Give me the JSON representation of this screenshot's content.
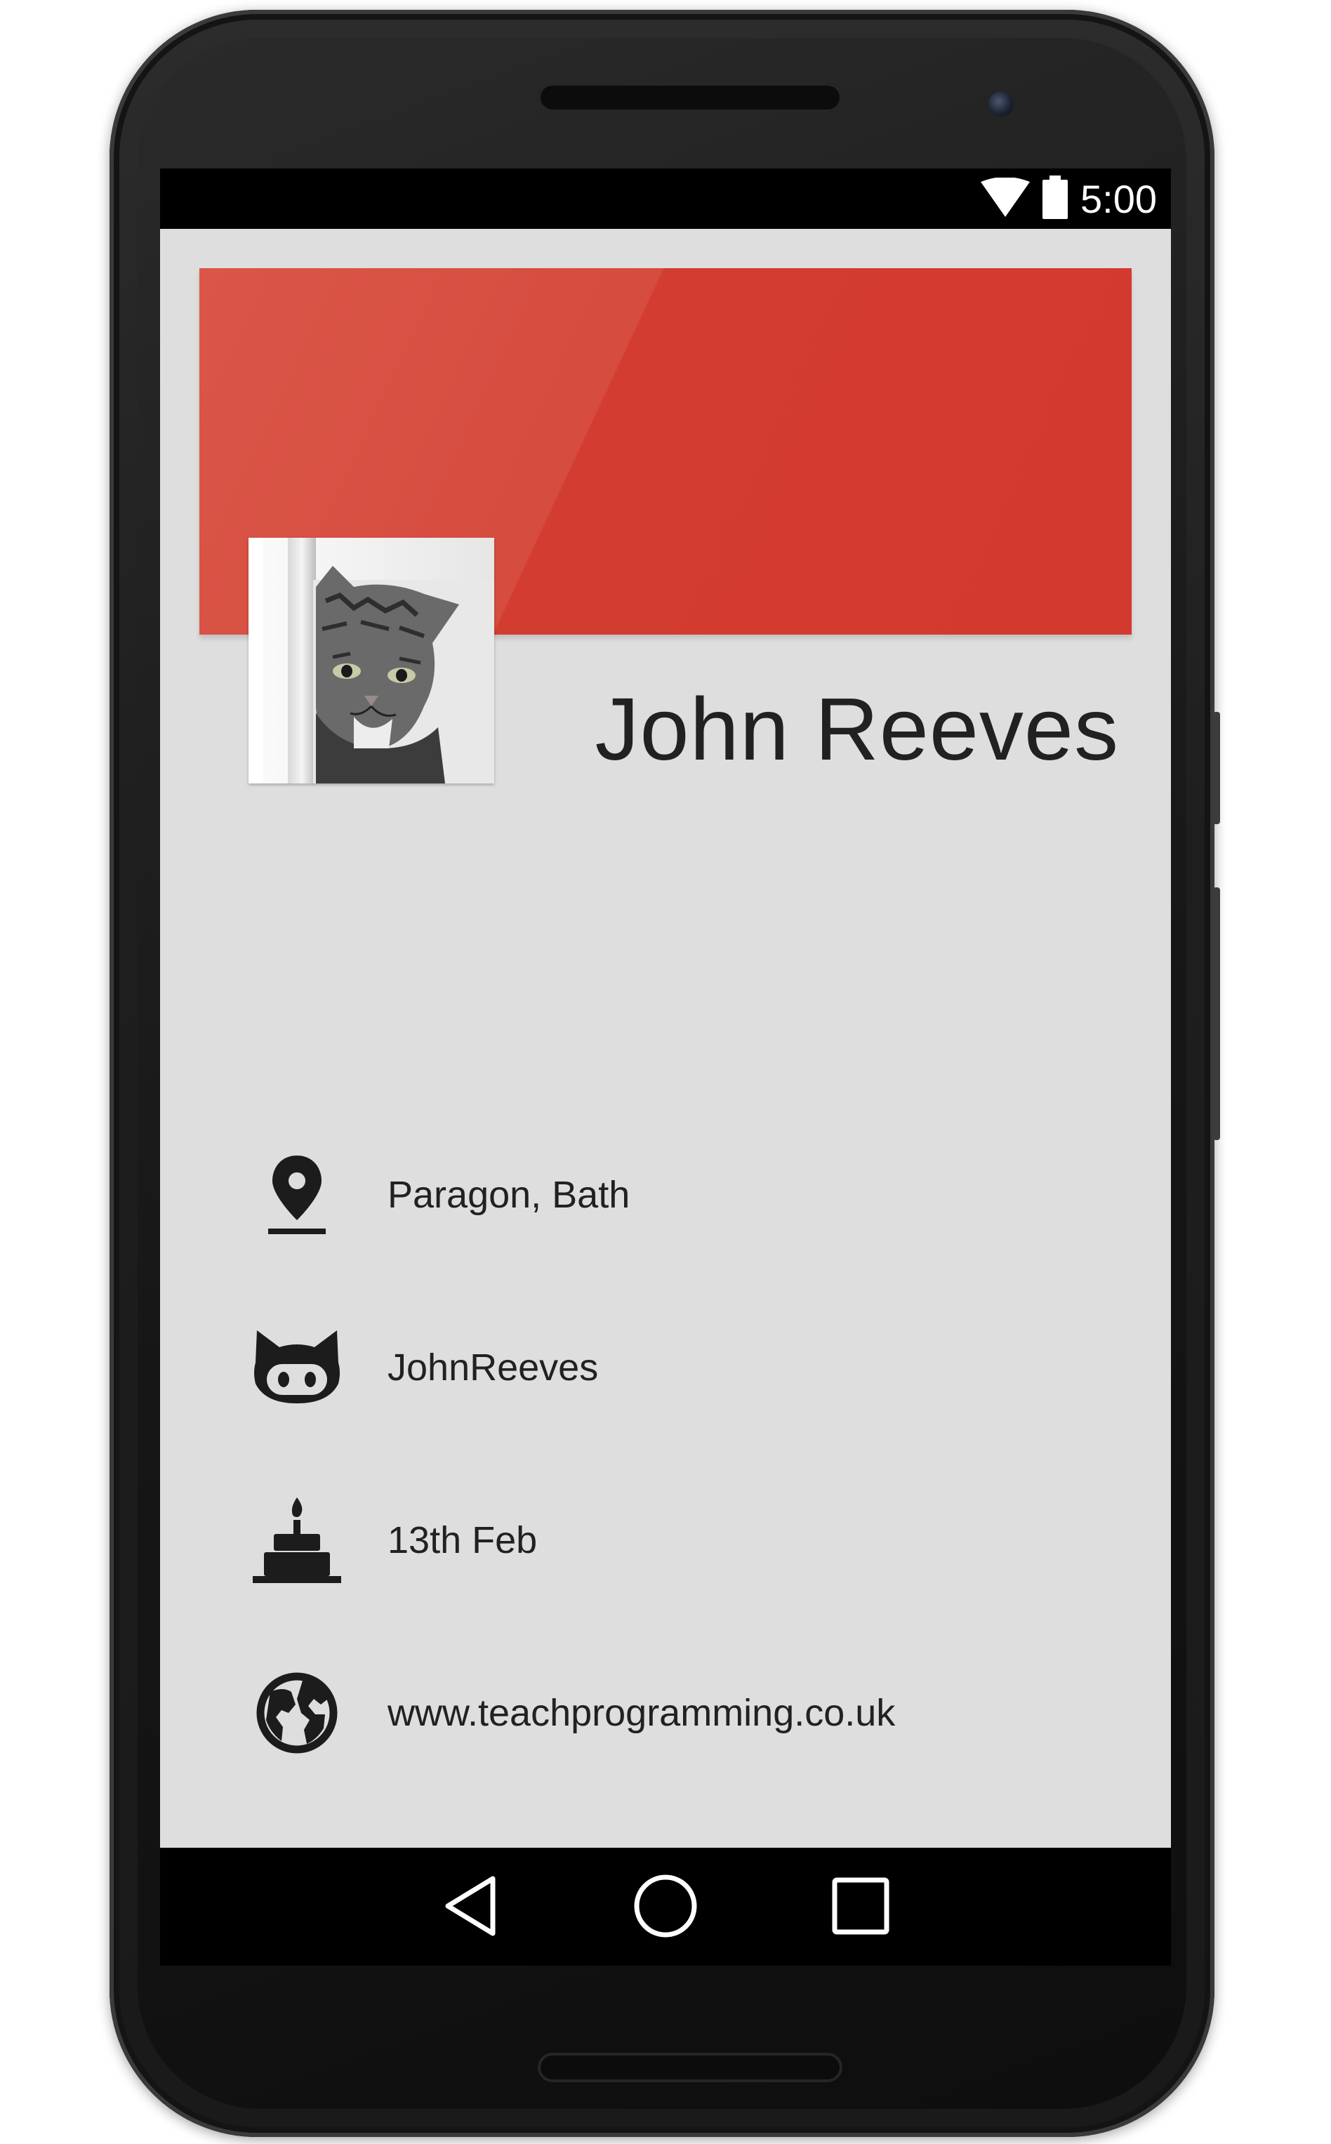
{
  "status_bar": {
    "time": "5:00",
    "wifi_icon": "wifi-icon",
    "battery_icon": "battery-icon"
  },
  "profile": {
    "name": "John Reeves",
    "avatar": "cat-photo",
    "header_color": "#d33a2f"
  },
  "info": [
    {
      "icon": "location-pin-icon",
      "text": "Paragon, Bath"
    },
    {
      "icon": "github-icon",
      "text": "JohnReeves"
    },
    {
      "icon": "cake-icon",
      "text": "13th Feb"
    },
    {
      "icon": "globe-icon",
      "text": "www.teachprogramming.co.uk"
    }
  ],
  "nav_bar": {
    "back_icon": "back-icon",
    "home_icon": "home-icon",
    "recents_icon": "recents-icon"
  },
  "colors": {
    "accent": "#d33a2f",
    "background": "#dedede",
    "text": "#212121"
  }
}
